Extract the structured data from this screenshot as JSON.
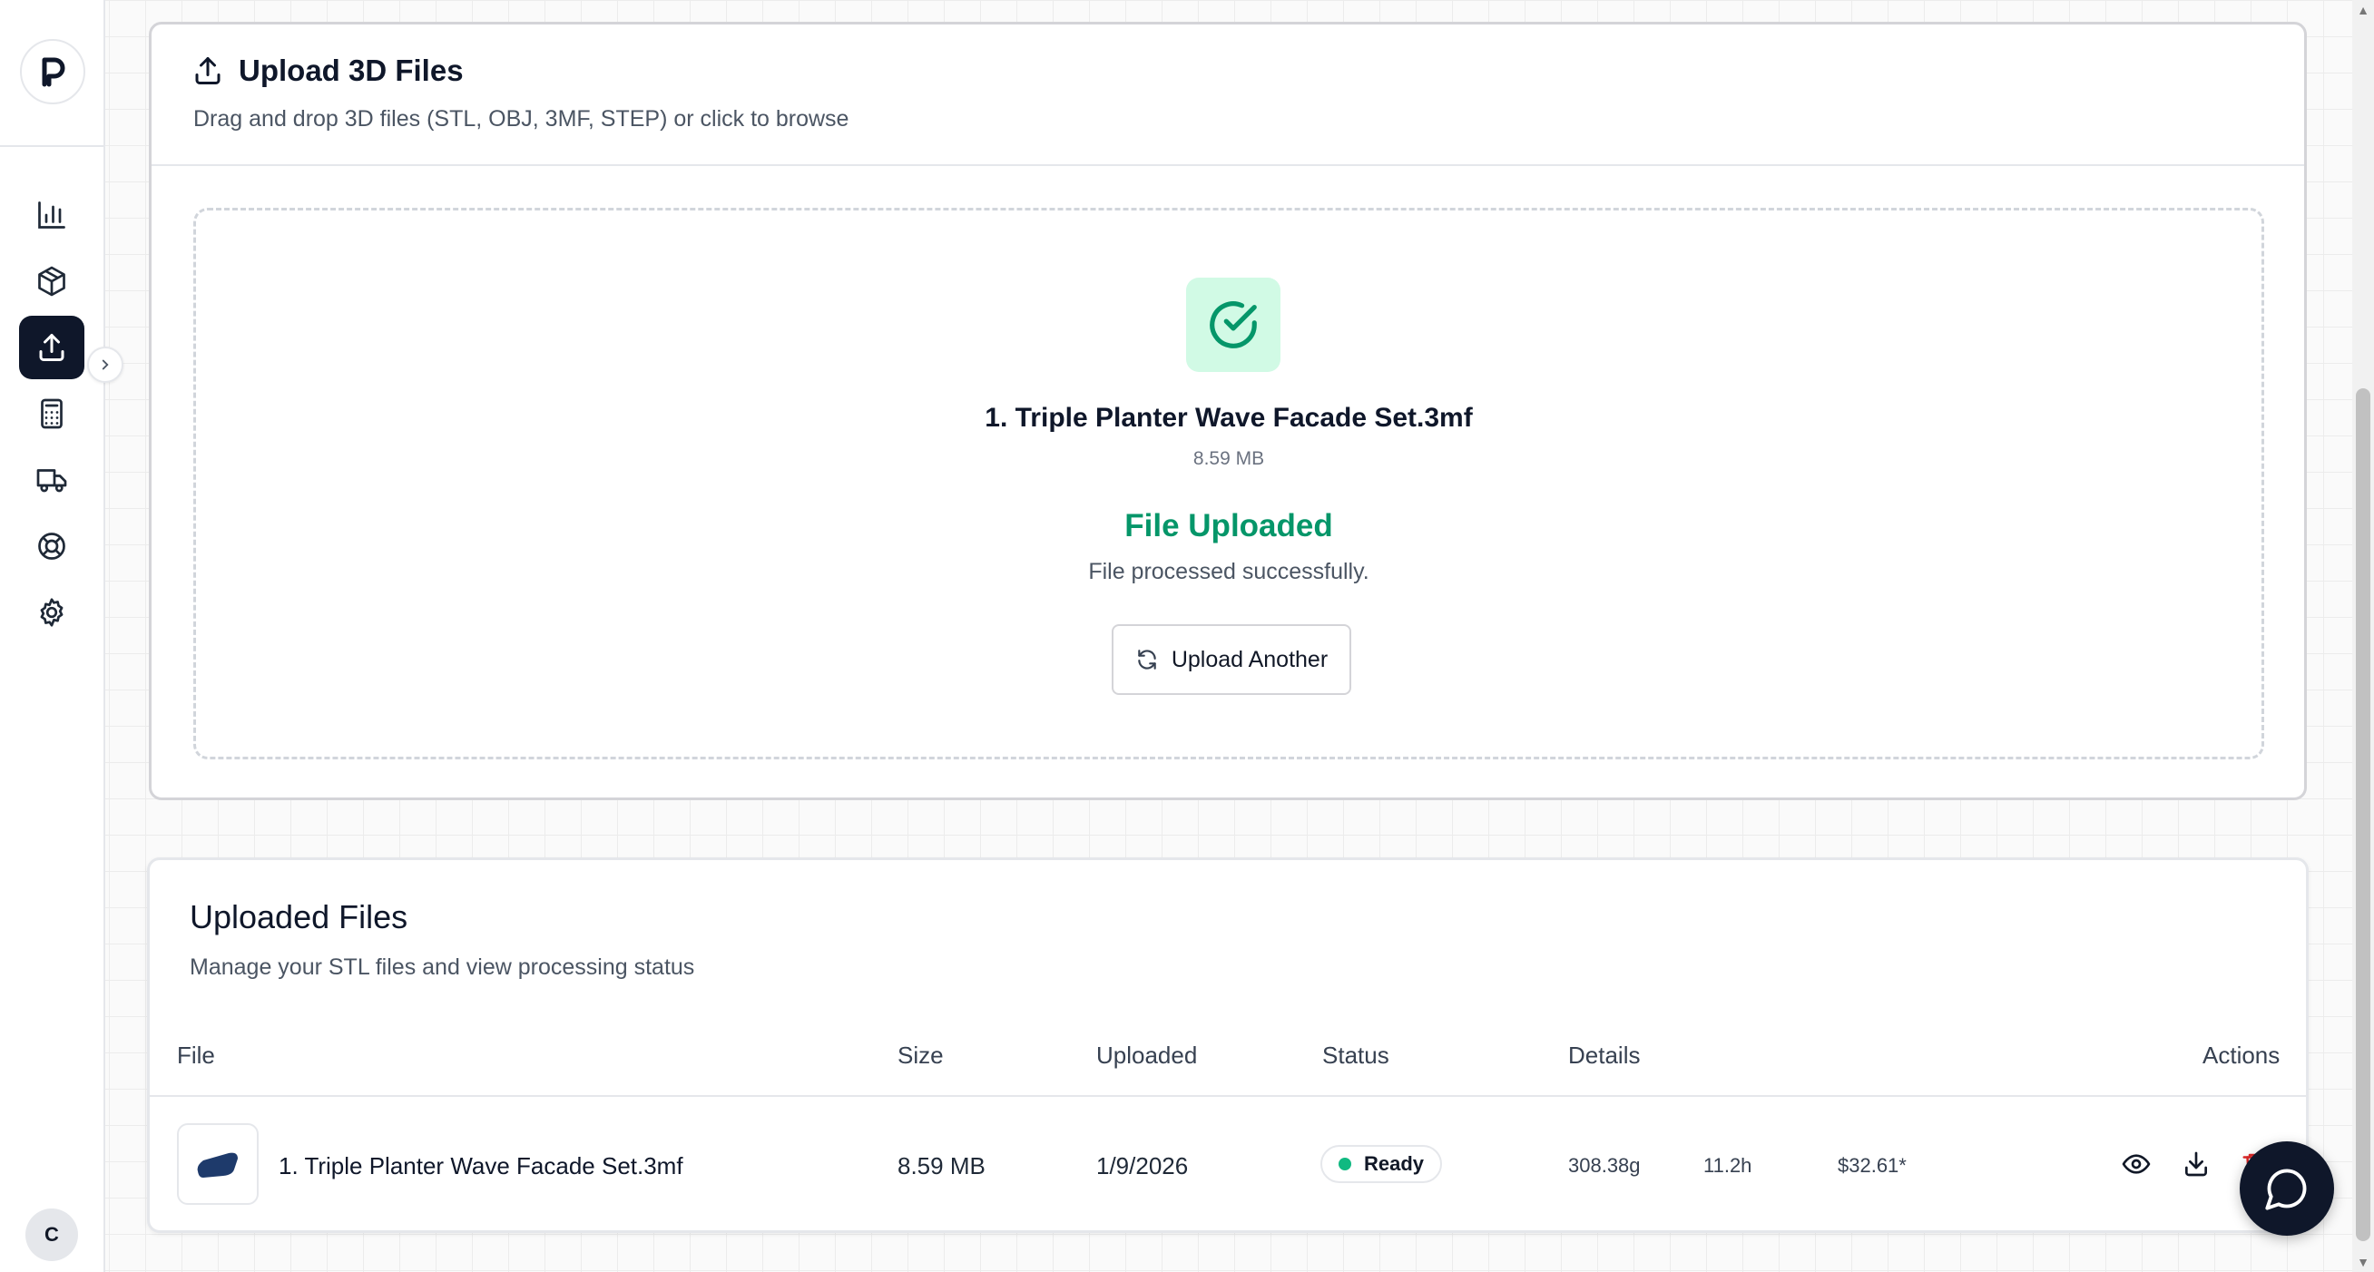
{
  "sidebar": {
    "logo_letter": "P",
    "avatar_initial": "C",
    "nav_items": [
      {
        "icon": "bar-chart-icon",
        "label": "Analytics"
      },
      {
        "icon": "package-icon",
        "label": "Products"
      },
      {
        "icon": "upload-icon",
        "label": "Upload",
        "active": true
      },
      {
        "icon": "calculator-icon",
        "label": "Calculator"
      },
      {
        "icon": "truck-icon",
        "label": "Shipping"
      },
      {
        "icon": "lifebuoy-icon",
        "label": "Support"
      },
      {
        "icon": "gear-icon",
        "label": "Settings"
      }
    ]
  },
  "upload": {
    "title": "Upload 3D Files",
    "subtitle": "Drag and drop 3D files (STL, OBJ, 3MF, STEP) or click to browse",
    "file_name": "1. Triple Planter Wave Facade Set.3mf",
    "file_size": "8.59 MB",
    "status_title": "File Uploaded",
    "status_message": "File processed successfully.",
    "upload_another_label": "Upload Another",
    "success_color": "#059669"
  },
  "files": {
    "title": "Uploaded Files",
    "subtitle": "Manage your STL files and view processing status",
    "columns": {
      "file": "File",
      "size": "Size",
      "uploaded": "Uploaded",
      "status": "Status",
      "details": "Details",
      "actions": "Actions"
    },
    "rows": [
      {
        "name": "1. Triple Planter Wave Facade Set.3mf",
        "size": "8.59 MB",
        "uploaded": "1/9/2026",
        "status": "Ready",
        "weight": "308.38g",
        "time": "11.2h",
        "price": "$32.61*"
      }
    ]
  },
  "colors": {
    "primary": "#0f172a",
    "success": "#10b981",
    "danger": "#dc2626"
  }
}
